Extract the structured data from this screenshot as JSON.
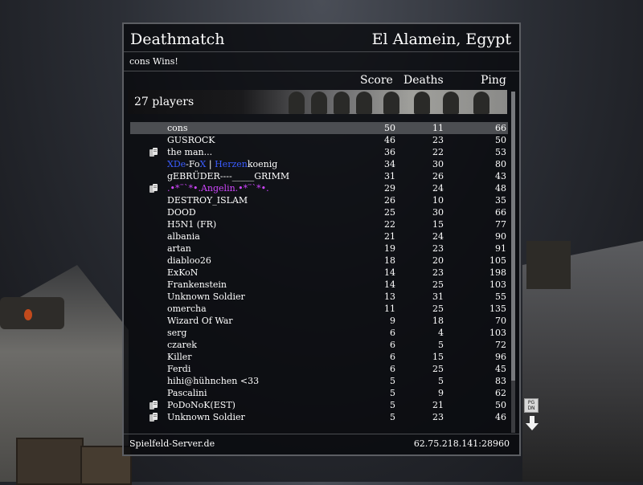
{
  "header": {
    "mode": "Deathmatch",
    "map": "El Alamein, Egypt"
  },
  "winner_text": "cons Wins!",
  "columns": {
    "score": "Score",
    "deaths": "Deaths",
    "ping": "Ping"
  },
  "players_label": "27 players",
  "players": [
    {
      "name": "cons",
      "score": "50",
      "deaths": "11",
      "ping": "66",
      "icon": "",
      "self": true
    },
    {
      "name": "GUSROCK",
      "score": "46",
      "deaths": "23",
      "ping": "50",
      "icon": ""
    },
    {
      "name": "the man...",
      "score": "36",
      "deaths": "22",
      "ping": "53",
      "icon": "dog-tags-icon"
    },
    {
      "name": "",
      "score": "34",
      "deaths": "30",
      "ping": "80",
      "icon": "",
      "parts": [
        {
          "text": "XDe",
          "color": "#3a5cff"
        },
        {
          "text": "-Fo",
          "color": "#ffffff"
        },
        {
          "text": "X",
          "color": "#3a5cff"
        },
        {
          "text": " | ",
          "color": "#ffffff"
        },
        {
          "text": "Herzen",
          "color": "#3a5cff"
        },
        {
          "text": "koenig",
          "color": "#ffffff"
        }
      ]
    },
    {
      "name": "gEBRÜDER----_____GRIMM",
      "score": "31",
      "deaths": "26",
      "ping": "43",
      "icon": ""
    },
    {
      "name": ".•*¨`*•.Angelin.•*¨`*•.",
      "score": "29",
      "deaths": "24",
      "ping": "48",
      "icon": "dog-tags-icon",
      "color": "#d046ff"
    },
    {
      "name": "DESTROY_ISLAM",
      "score": "26",
      "deaths": "10",
      "ping": "35",
      "icon": ""
    },
    {
      "name": "DOOD",
      "score": "25",
      "deaths": "30",
      "ping": "66",
      "icon": ""
    },
    {
      "name": "H5N1 (FR)",
      "score": "22",
      "deaths": "15",
      "ping": "77",
      "icon": ""
    },
    {
      "name": "albania",
      "score": "21",
      "deaths": "24",
      "ping": "90",
      "icon": ""
    },
    {
      "name": "artan",
      "score": "19",
      "deaths": "23",
      "ping": "91",
      "icon": ""
    },
    {
      "name": "diabloo26",
      "score": "18",
      "deaths": "20",
      "ping": "105",
      "icon": ""
    },
    {
      "name": "ExKoN",
      "score": "14",
      "deaths": "23",
      "ping": "198",
      "icon": ""
    },
    {
      "name": "Frankenstein",
      "score": "14",
      "deaths": "25",
      "ping": "103",
      "icon": ""
    },
    {
      "name": "Unknown Soldier",
      "score": "13",
      "deaths": "31",
      "ping": "55",
      "icon": ""
    },
    {
      "name": "omercha",
      "score": "11",
      "deaths": "25",
      "ping": "135",
      "icon": ""
    },
    {
      "name": "Wizard Of War",
      "score": "9",
      "deaths": "18",
      "ping": "70",
      "icon": ""
    },
    {
      "name": "serg",
      "score": "6",
      "deaths": "4",
      "ping": "103",
      "icon": ""
    },
    {
      "name": "czarek",
      "score": "6",
      "deaths": "5",
      "ping": "72",
      "icon": ""
    },
    {
      "name": "Killer",
      "score": "6",
      "deaths": "15",
      "ping": "96",
      "icon": ""
    },
    {
      "name": "Ferdi",
      "score": "6",
      "deaths": "25",
      "ping": "45",
      "icon": ""
    },
    {
      "name": "hihi@hühnchen <33",
      "score": "5",
      "deaths": "5",
      "ping": "83",
      "icon": ""
    },
    {
      "name": "Pascalini",
      "score": "5",
      "deaths": "9",
      "ping": "62",
      "icon": ""
    },
    {
      "name": "PoDoNoK(EST)",
      "score": "5",
      "deaths": "21",
      "ping": "50",
      "icon": "dog-tags-icon"
    },
    {
      "name": "Unknown Soldier",
      "score": "5",
      "deaths": "23",
      "ping": "46",
      "icon": "dog-tags-icon"
    }
  ],
  "footer": {
    "server_name": "Spielfeld-Server.de",
    "server_address": "62.75.218.141:28960"
  },
  "pgdn_label": "PG DN"
}
